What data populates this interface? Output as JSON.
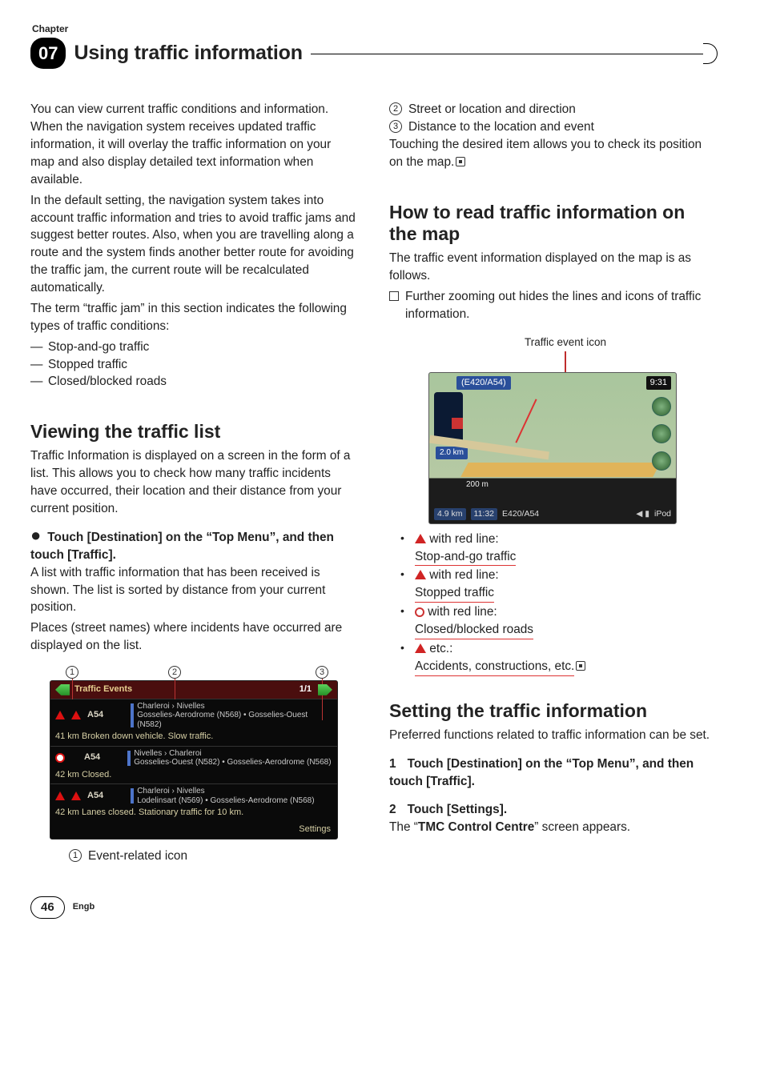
{
  "chapter_label": "Chapter",
  "chapter_number": "07",
  "page_title": "Using traffic information",
  "left": {
    "intro_p1": "You can view current traffic conditions and information. When the navigation system receives updated traffic information, it will overlay the traffic information on your map and also display detailed text information when available.",
    "intro_p2": "In the default setting, the navigation system takes into account traffic information and tries to avoid traffic jams and suggest better routes. Also, when you are travelling along a route and the system finds another better route for avoiding the traffic jam, the current route will be recalculated automatically.",
    "intro_p3": "The term “traffic jam” in this section indicates the following types of traffic conditions:",
    "dash_items": [
      "Stop-and-go traffic",
      "Stopped traffic",
      "Closed/blocked roads"
    ],
    "sec1_title": "Viewing the traffic list",
    "sec1_p1": "Traffic Information is displayed on a screen in the form of a list. This allows you to check how many traffic incidents have occurred, their location and their distance from your current position.",
    "sec1_step": "Touch [Destination] on the “Top Menu”, and then touch [Traffic].",
    "sec1_p2": "A list with traffic information that has been received is shown. The list is sorted by distance from your current position.",
    "sec1_p3": "Places (street names) where incidents have occurred are displayed on the list.",
    "legend1": "Event-related icon"
  },
  "traffic_list": {
    "title": "Traffic Events",
    "page_indicator": "1/1",
    "rows": [
      {
        "road": "A54",
        "dir": "Charleroi › Nivelles",
        "pts": "Gosselies-Aerodrome (N568)\n• Gosselies-Ouest (N582)",
        "footer": "41 km Broken down vehicle. Slow traffic.",
        "icon": "double-tri"
      },
      {
        "road": "A54",
        "dir": "Nivelles › Charleroi",
        "pts": "Gosselies-Ouest (N582)\n• Gosselies-Aerodrome (N568)",
        "footer": "42 km Closed.",
        "icon": "circle"
      },
      {
        "road": "A54",
        "dir": "Charleroi › Nivelles",
        "pts": "Lodelinsart (N569) • Gosselies-Aerodrome (N568)",
        "footer": "42 km Lanes closed. Stationary traffic for 10 km.",
        "icon": "double-tri"
      }
    ],
    "settings": "Settings"
  },
  "right": {
    "legend2": "Street or location and direction",
    "legend3": "Distance to the location and event",
    "touch_note": "Touching the desired item allows you to check its position on the map.",
    "sec2_title": "How to read traffic information on the map",
    "sec2_p1": "The traffic event information displayed on the map is as follows.",
    "sec2_note": "Further zooming out hides the lines and icons of traffic information.",
    "map_label": "Traffic event icon",
    "map": {
      "sign": "(E420/A54)",
      "time": "9:31",
      "distance_badge": "2.0 km",
      "scale": "200 m",
      "next_dist": "4.9 km",
      "eta": "11:32",
      "bottom_road": "E420/A54",
      "bottom_src": "iPod"
    },
    "bullets": [
      {
        "icon": "tri",
        "line1": "with red line:",
        "line2": "Stop-and-go traffic"
      },
      {
        "icon": "tri",
        "line1": "with red line:",
        "line2": "Stopped traffic"
      },
      {
        "icon": "circ",
        "line1": "with red line:",
        "line2": "Closed/blocked roads"
      },
      {
        "icon": "tri",
        "line1": "etc.:",
        "line2": "Accidents, constructions, etc."
      }
    ],
    "sec3_title": "Setting the traffic information",
    "sec3_p1": "Preferred functions related to traffic information can be set.",
    "sec3_step1_num": "1",
    "sec3_step1": "Touch [Destination] on the “Top Menu”, and then touch [Traffic].",
    "sec3_step2_num": "2",
    "sec3_step2": "Touch [Settings].",
    "sec3_p2a": "The “",
    "sec3_p2b": "TMC Control Centre",
    "sec3_p2c": "” screen appears."
  },
  "footer": {
    "page": "46",
    "lang": "Engb"
  }
}
